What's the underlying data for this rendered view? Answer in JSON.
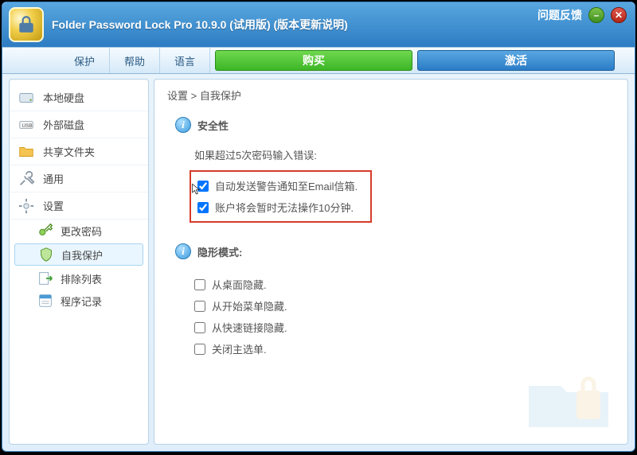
{
  "title": "Folder Password Lock Pro 10.9.0 (试用版) (版本更新说明)",
  "feedback_link": "问题反馈",
  "toolbar": {
    "protect": "保护",
    "help": "帮助",
    "language": "语言",
    "buy": "购买",
    "activate": "激活"
  },
  "sidebar": {
    "local_disk": "本地硬盘",
    "external_disk": "外部磁盘",
    "shared_folders": "共享文件夹",
    "general": "通用",
    "settings": "设置",
    "sub": {
      "change_password": "更改密码",
      "self_protection": "自我保护",
      "exclusion_list": "排除列表",
      "program_log": "程序记录"
    }
  },
  "breadcrumb": "设置 > 自我保护",
  "security": {
    "title": "安全性",
    "intro": "如果超过5次密码输入错误:",
    "opt_email": "自动发送警告通知至Email信箱.",
    "opt_lock": "账户将会暂时无法操作10分钟."
  },
  "stealth": {
    "title": "隐形模式:",
    "opt_desktop": "从桌面隐藏.",
    "opt_startmenu": "从开始菜单隐藏.",
    "opt_quicklaunch": "从快速链接隐藏.",
    "opt_closemain": "关闭主选单."
  }
}
